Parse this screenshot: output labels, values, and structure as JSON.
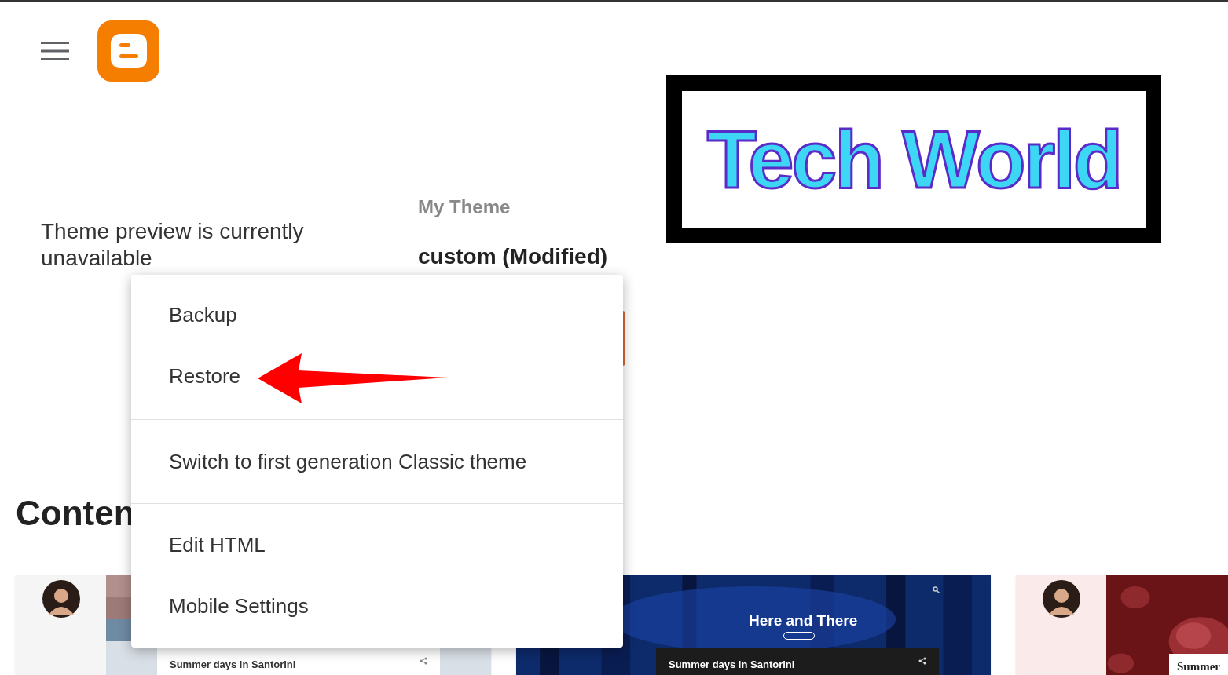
{
  "preview_message": "Theme preview is currently unavailable",
  "theme": {
    "label": "My Theme",
    "name": "custom (Modified)"
  },
  "section_title": "Conten",
  "theme_cards": [
    {
      "kind": "light",
      "title": "Summer days in Santorini"
    },
    {
      "kind": "forest",
      "heading": "Here and There",
      "title": "Summer days in Santorini"
    },
    {
      "kind": "floral",
      "title": "Summer"
    }
  ],
  "menu": {
    "groups": [
      {
        "items": [
          {
            "label": "Backup"
          },
          {
            "label": "Restore"
          }
        ]
      },
      {
        "items": [
          {
            "label": "Switch to first generation Classic theme"
          }
        ]
      },
      {
        "items": [
          {
            "label": "Edit HTML"
          },
          {
            "label": "Mobile Settings"
          }
        ]
      }
    ]
  },
  "banner": {
    "text": "Tech World"
  }
}
